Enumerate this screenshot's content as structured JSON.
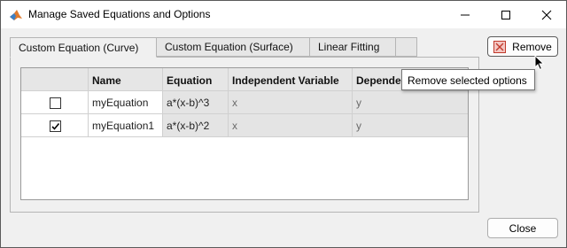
{
  "window": {
    "title": "Manage Saved Equations and Options",
    "app_icon": "matlab-icon",
    "controls": [
      "minimize-icon",
      "maximize-icon",
      "close-icon"
    ]
  },
  "tabs": [
    {
      "label": "Custom Equation (Curve)",
      "active": true
    },
    {
      "label": "Custom Equation (Surface)",
      "active": false
    },
    {
      "label": "Linear Fitting",
      "active": false
    }
  ],
  "table": {
    "columns": [
      "",
      "Name",
      "Equation",
      "Independent Variable",
      "Depende"
    ],
    "rows": [
      {
        "checked": false,
        "name": "myEquation",
        "equation": "a*(x-b)^3",
        "independent": "x",
        "dependent": "y"
      },
      {
        "checked": true,
        "name": "myEquation1",
        "equation": "a*(x-b)^2",
        "independent": "x",
        "dependent": "y"
      }
    ]
  },
  "buttons": {
    "remove_label": "Remove",
    "close_label": "Close"
  },
  "tooltip": {
    "text": "Remove selected options"
  },
  "colors": {
    "remove_icon": "#d9534f",
    "header_bg": "#e6e6e6",
    "cell_gray": "#e4e4e4"
  }
}
